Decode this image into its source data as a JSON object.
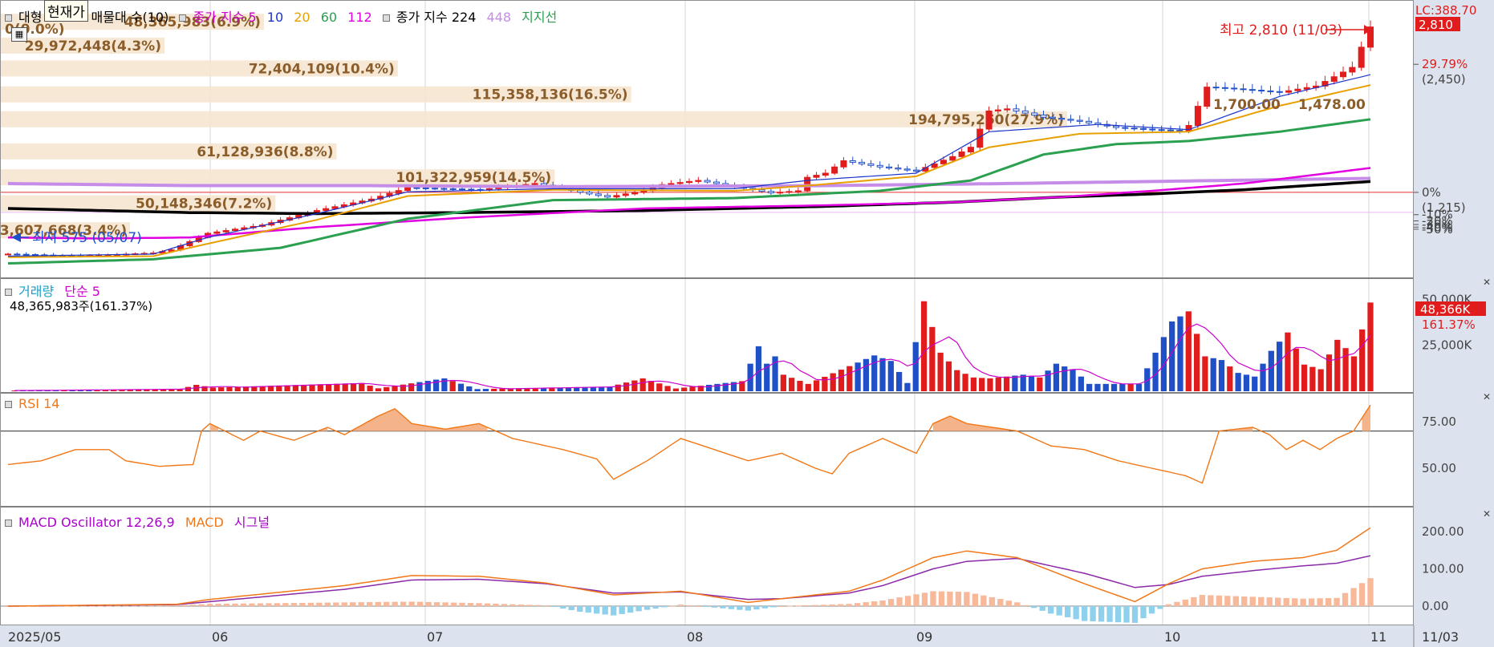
{
  "header": {
    "tab_left": "대형",
    "tooltip": "현재가",
    "tab_right": "매물대 수(10)",
    "ma_label": "종가 지수 5",
    "ma_periods": [
      "10",
      "20",
      "60",
      "112"
    ],
    "ma224_label": "종가 지수 224",
    "ma448_label": "448",
    "support_label": "지지선",
    "colors": {
      "5": "#cc00cc",
      "10": "#1a35c8",
      "20": "#e8a000",
      "60": "#2aa050",
      "112": "#e000e0",
      "224": "#000000",
      "448": "#c58de8"
    }
  },
  "price_axis": {
    "top_label": "LC:388.70",
    "ticks": [
      {
        "pct": "29.79%",
        "value": "(2,450)",
        "price": 2450
      },
      {
        "pct": "0%",
        "value": "(1,215)",
        "price": 1215
      },
      {
        "pct": "-10%",
        "value": "",
        "price": 1000
      },
      {
        "pct": "-20%",
        "value": "",
        "price": 940
      },
      {
        "pct": "-30%",
        "value": "",
        "price": 905
      },
      {
        "pct": "-40%",
        "value": "",
        "price": 880
      },
      {
        "pct": "-50%",
        "value": "",
        "price": 860
      }
    ],
    "current_badge": "2,810",
    "baseline_price": 1215
  },
  "annotations": {
    "high": "최고 2,810 (11/03)",
    "low": "최저 575 (05/07)",
    "near_right": "1,700.00",
    "right_value": "1,478.00"
  },
  "volume_panel": {
    "title": "거래량",
    "ma_label": "단순 5",
    "current": "48,365,983주(161.37%)",
    "axis_ticks": [
      "50,000K",
      "25,000K"
    ],
    "badge": "48,366K",
    "badge_pct": "161.37%"
  },
  "rsi_panel": {
    "title": "RSI 14",
    "axis_ticks": [
      "75.00",
      "50.00"
    ]
  },
  "macd_panel": {
    "title": "MACD Oscillator 12,26,9",
    "macd_label": "MACD",
    "signal_label": "시그널",
    "axis_ticks": [
      "200.00",
      "100.00",
      "0.00"
    ]
  },
  "x_axis": {
    "labels": [
      "2025/05",
      "06",
      "07",
      "08",
      "09",
      "10",
      "11"
    ],
    "right_label": "11/03"
  },
  "chart_data": {
    "type": "candlestick",
    "price_range": [
      480,
      2900
    ],
    "volume_profile": [
      {
        "label": "48,365,983(6.9%)",
        "price": 2860,
        "share": 6.9
      },
      {
        "label": "0(0.0%)",
        "price": 2790,
        "share": 0.0
      },
      {
        "label": "29,972,448(4.3%)",
        "price": 2630,
        "share": 4.3
      },
      {
        "label": "72,404,109(10.4%)",
        "price": 2410,
        "share": 10.4
      },
      {
        "label": "115,358,136(16.5%)",
        "price": 2160,
        "share": 16.5
      },
      {
        "label": "194,795,260(27.9%)",
        "price": 1920,
        "share": 27.9
      },
      {
        "label": "61,128,936(8.8%)",
        "price": 1610,
        "share": 8.8
      },
      {
        "label": "101,322,959(14.5%)",
        "price": 1360,
        "share": 14.5
      },
      {
        "label": "50,148,346(7.2%)",
        "price": 1110,
        "share": 7.2
      },
      {
        "label": "23,607,668(3.4%)",
        "price": 850,
        "share": 3.4
      }
    ],
    "price_anchors": [
      [
        0,
        620
      ],
      [
        8,
        600
      ],
      [
        16,
        630
      ],
      [
        18,
        660
      ],
      [
        22,
        820
      ],
      [
        28,
        900
      ],
      [
        34,
        1040
      ],
      [
        40,
        1150
      ],
      [
        44,
        1260
      ],
      [
        52,
        1240
      ],
      [
        58,
        1300
      ],
      [
        64,
        1200
      ],
      [
        66,
        1170
      ],
      [
        70,
        1230
      ],
      [
        72,
        1290
      ],
      [
        76,
        1330
      ],
      [
        80,
        1270
      ],
      [
        84,
        1210
      ],
      [
        87,
        1230
      ],
      [
        88,
        1360
      ],
      [
        90,
        1400
      ],
      [
        92,
        1520
      ],
      [
        96,
        1460
      ],
      [
        100,
        1420
      ],
      [
        104,
        1560
      ],
      [
        106,
        1650
      ],
      [
        108,
        2000
      ],
      [
        110,
        2020
      ],
      [
        114,
        1940
      ],
      [
        118,
        1900
      ],
      [
        122,
        1840
      ],
      [
        126,
        1820
      ],
      [
        129,
        1810
      ],
      [
        130,
        1860
      ],
      [
        132,
        2230
      ],
      [
        134,
        2220
      ],
      [
        140,
        2180
      ],
      [
        144,
        2240
      ],
      [
        148,
        2420
      ],
      [
        150,
        2810
      ]
    ],
    "ma_anchors": {
      "10": [
        [
          0,
          600
        ],
        [
          16,
          620
        ],
        [
          22,
          780
        ],
        [
          34,
          1010
        ],
        [
          44,
          1220
        ],
        [
          60,
          1250
        ],
        [
          80,
          1250
        ],
        [
          88,
          1330
        ],
        [
          100,
          1400
        ],
        [
          108,
          1800
        ],
        [
          120,
          1870
        ],
        [
          130,
          1820
        ],
        [
          140,
          2140
        ],
        [
          150,
          2350
        ]
      ],
      "20": [
        [
          0,
          590
        ],
        [
          16,
          600
        ],
        [
          22,
          720
        ],
        [
          34,
          950
        ],
        [
          44,
          1180
        ],
        [
          60,
          1240
        ],
        [
          80,
          1230
        ],
        [
          88,
          1280
        ],
        [
          100,
          1370
        ],
        [
          108,
          1650
        ],
        [
          118,
          1780
        ],
        [
          130,
          1800
        ],
        [
          140,
          2050
        ],
        [
          150,
          2250
        ]
      ],
      "60": [
        [
          0,
          530
        ],
        [
          16,
          570
        ],
        [
          30,
          680
        ],
        [
          44,
          960
        ],
        [
          60,
          1140
        ],
        [
          80,
          1160
        ],
        [
          96,
          1230
        ],
        [
          106,
          1330
        ],
        [
          114,
          1580
        ],
        [
          122,
          1680
        ],
        [
          130,
          1710
        ],
        [
          140,
          1800
        ],
        [
          150,
          1920
        ]
      ],
      "112": [
        [
          0,
          780
        ],
        [
          10,
          770
        ],
        [
          20,
          780
        ],
        [
          34,
          880
        ],
        [
          50,
          970
        ],
        [
          70,
          1060
        ],
        [
          90,
          1090
        ],
        [
          104,
          1120
        ],
        [
          116,
          1170
        ],
        [
          126,
          1230
        ],
        [
          136,
          1300
        ],
        [
          150,
          1450
        ]
      ],
      "224": [
        [
          0,
          1060
        ],
        [
          20,
          1020
        ],
        [
          34,
          1010
        ],
        [
          50,
          1020
        ],
        [
          70,
          1040
        ],
        [
          90,
          1080
        ],
        [
          104,
          1120
        ],
        [
          116,
          1170
        ],
        [
          126,
          1200
        ],
        [
          136,
          1240
        ],
        [
          150,
          1320
        ]
      ],
      "448": [
        [
          0,
          1300
        ],
        [
          20,
          1280
        ],
        [
          40,
          1280
        ],
        [
          60,
          1270
        ],
        [
          90,
          1280
        ],
        [
          110,
          1300
        ],
        [
          126,
          1320
        ],
        [
          150,
          1350
        ]
      ]
    },
    "volume_anchors": [
      [
        0,
        0.4
      ],
      [
        20,
        1.2
      ],
      [
        22,
        3.5
      ],
      [
        24,
        2.0
      ],
      [
        42,
        4.5
      ],
      [
        44,
        1.6
      ],
      [
        52,
        7
      ],
      [
        56,
        1.2
      ],
      [
        72,
        2.5
      ],
      [
        76,
        7
      ],
      [
        80,
        1.5
      ],
      [
        88,
        5.5
      ],
      [
        90,
        24.5
      ],
      [
        91,
        15
      ],
      [
        92,
        19
      ],
      [
        93,
        9
      ],
      [
        96,
        4
      ],
      [
        104,
        19.5
      ],
      [
        106,
        16.5
      ],
      [
        108,
        4.5
      ],
      [
        110,
        49
      ],
      [
        112,
        21
      ],
      [
        114,
        11.5
      ],
      [
        116,
        7.5
      ],
      [
        118,
        7
      ],
      [
        122,
        9
      ],
      [
        124,
        7.5
      ],
      [
        126,
        15
      ],
      [
        128,
        12
      ],
      [
        130,
        4
      ],
      [
        132,
        4
      ],
      [
        136,
        4
      ],
      [
        140,
        38
      ],
      [
        142,
        43.5
      ],
      [
        144,
        19
      ],
      [
        146,
        17
      ],
      [
        148,
        10
      ],
      [
        150,
        8
      ],
      [
        152,
        22
      ],
      [
        154,
        32
      ],
      [
        156,
        14.5
      ],
      [
        158,
        12
      ],
      [
        160,
        28
      ],
      [
        162,
        19
      ],
      [
        164,
        48.3
      ]
    ],
    "rsi_anchors": [
      [
        0,
        52
      ],
      [
        4,
        54
      ],
      [
        8,
        60
      ],
      [
        12,
        60
      ],
      [
        14,
        54
      ],
      [
        18,
        51
      ],
      [
        22,
        52
      ],
      [
        23,
        70
      ],
      [
        24,
        74
      ],
      [
        28,
        65
      ],
      [
        30,
        70
      ],
      [
        34,
        65
      ],
      [
        38,
        72
      ],
      [
        40,
        68
      ],
      [
        44,
        78
      ],
      [
        46,
        82
      ],
      [
        48,
        74
      ],
      [
        52,
        71
      ],
      [
        56,
        74
      ],
      [
        60,
        66
      ],
      [
        64,
        62
      ],
      [
        66,
        60
      ],
      [
        70,
        55
      ],
      [
        72,
        44
      ],
      [
        76,
        54
      ],
      [
        80,
        66
      ],
      [
        84,
        60
      ],
      [
        88,
        54
      ],
      [
        92,
        58
      ],
      [
        96,
        50
      ],
      [
        98,
        47
      ],
      [
        100,
        58
      ],
      [
        104,
        66
      ],
      [
        106,
        62
      ],
      [
        108,
        58
      ],
      [
        110,
        74
      ],
      [
        112,
        78
      ],
      [
        114,
        74
      ],
      [
        120,
        70
      ],
      [
        124,
        62
      ],
      [
        128,
        60
      ],
      [
        132,
        54
      ],
      [
        136,
        50
      ],
      [
        140,
        46
      ],
      [
        142,
        42
      ],
      [
        144,
        70
      ],
      [
        148,
        72
      ],
      [
        150,
        68
      ],
      [
        152,
        60
      ],
      [
        154,
        65
      ],
      [
        156,
        60
      ],
      [
        158,
        66
      ],
      [
        160,
        70
      ],
      [
        162,
        84
      ]
    ],
    "macd_anchors": [
      [
        0,
        0
      ],
      [
        20,
        5
      ],
      [
        24,
        18
      ],
      [
        40,
        55
      ],
      [
        48,
        82
      ],
      [
        56,
        80
      ],
      [
        64,
        62
      ],
      [
        72,
        30
      ],
      [
        80,
        40
      ],
      [
        88,
        10
      ],
      [
        92,
        20
      ],
      [
        100,
        40
      ],
      [
        104,
        70
      ],
      [
        110,
        130
      ],
      [
        114,
        148
      ],
      [
        120,
        130
      ],
      [
        128,
        60
      ],
      [
        134,
        12
      ],
      [
        138,
        60
      ],
      [
        142,
        100
      ],
      [
        148,
        120
      ],
      [
        154,
        130
      ],
      [
        158,
        150
      ],
      [
        162,
        210
      ]
    ],
    "signal_anchors": [
      [
        0,
        0
      ],
      [
        20,
        4
      ],
      [
        24,
        12
      ],
      [
        40,
        45
      ],
      [
        48,
        70
      ],
      [
        56,
        72
      ],
      [
        64,
        60
      ],
      [
        72,
        35
      ],
      [
        80,
        38
      ],
      [
        88,
        18
      ],
      [
        92,
        20
      ],
      [
        100,
        35
      ],
      [
        104,
        55
      ],
      [
        110,
        100
      ],
      [
        114,
        120
      ],
      [
        120,
        128
      ],
      [
        128,
        88
      ],
      [
        134,
        50
      ],
      [
        138,
        58
      ],
      [
        142,
        80
      ],
      [
        148,
        95
      ],
      [
        154,
        108
      ],
      [
        158,
        115
      ],
      [
        162,
        135
      ]
    ],
    "osc_anchors": [
      [
        0,
        0
      ],
      [
        20,
        2
      ],
      [
        24,
        6
      ],
      [
        40,
        10
      ],
      [
        48,
        12
      ],
      [
        56,
        8
      ],
      [
        64,
        2
      ],
      [
        68,
        -15
      ],
      [
        72,
        -25
      ],
      [
        76,
        -10
      ],
      [
        80,
        4
      ],
      [
        88,
        -12
      ],
      [
        92,
        0
      ],
      [
        100,
        6
      ],
      [
        104,
        15
      ],
      [
        110,
        40
      ],
      [
        114,
        38
      ],
      [
        120,
        10
      ],
      [
        124,
        -20
      ],
      [
        128,
        -40
      ],
      [
        134,
        -45
      ],
      [
        138,
        5
      ],
      [
        142,
        30
      ],
      [
        148,
        25
      ],
      [
        154,
        20
      ],
      [
        158,
        22
      ],
      [
        162,
        75
      ]
    ]
  }
}
